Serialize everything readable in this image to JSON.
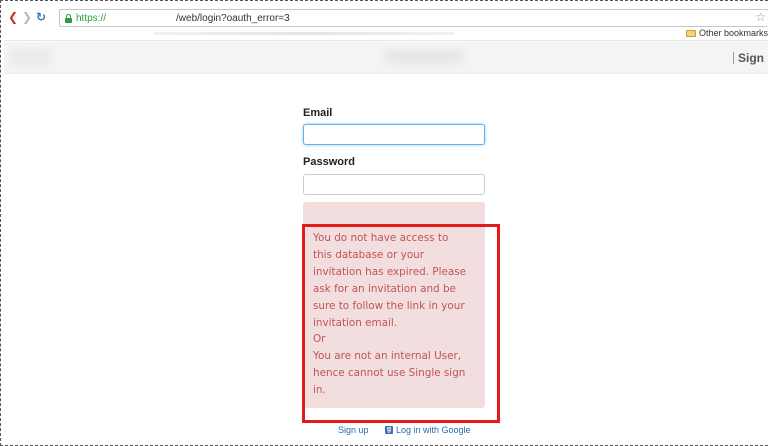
{
  "browser": {
    "url_scheme": "https://",
    "url_path": "/web/login?oauth_error=3",
    "bookmarks": {
      "other_label": "Other bookmarks"
    }
  },
  "header": {
    "sign_label": "Sign in"
  },
  "form": {
    "email_label": "Email",
    "email_value": "",
    "password_label": "Password",
    "password_value": ""
  },
  "alert": {
    "lines": [
      "You do not have access to",
      "this database or your",
      "invitation has expired. Please",
      "ask for an invitation and be",
      "sure to follow the link in your",
      "invitation email.",
      "Or",
      "You are not an internal User,",
      "hence cannot use Single sign",
      "in."
    ],
    "text_color": "#c15454",
    "background": "#f2dede"
  },
  "annotation": {
    "highlight_color": "#e41b1b"
  },
  "links": {
    "signup_label": "Sign up",
    "google_label": "Log in with Google"
  },
  "icons": {
    "back": "back-arrow-icon",
    "forward": "forward-arrow-icon",
    "reload": "reload-icon",
    "lock": "lock-icon",
    "star": "star-icon",
    "folder": "folder-icon",
    "google": "google-icon"
  }
}
